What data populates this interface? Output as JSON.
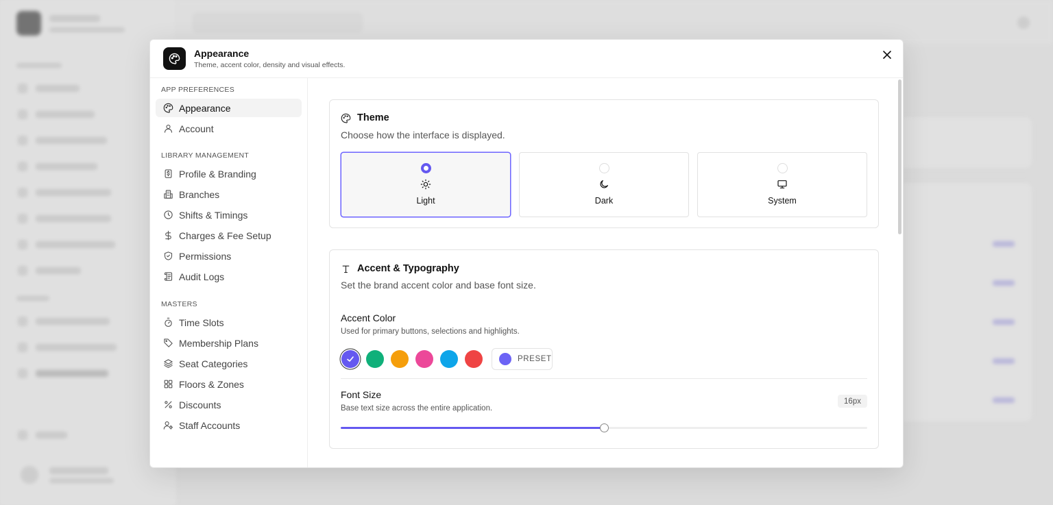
{
  "modal": {
    "title": "Appearance",
    "subtitle": "Theme, accent color, density and visual effects."
  },
  "nav": {
    "sections": [
      {
        "title": "APP PREFERENCES",
        "items": [
          {
            "label": "Appearance",
            "icon": "palette-icon",
            "active": true
          },
          {
            "label": "Account",
            "icon": "user-icon"
          }
        ]
      },
      {
        "title": "LIBRARY MANAGEMENT",
        "items": [
          {
            "label": "Profile & Branding",
            "icon": "badge-icon"
          },
          {
            "label": "Branches",
            "icon": "building-icon"
          },
          {
            "label": "Shifts & Timings",
            "icon": "clock-icon"
          },
          {
            "label": "Charges & Fee Setup",
            "icon": "dollar-icon"
          },
          {
            "label": "Permissions",
            "icon": "shield-check-icon"
          },
          {
            "label": "Audit Logs",
            "icon": "scroll-icon"
          }
        ]
      },
      {
        "title": "MASTERS",
        "items": [
          {
            "label": "Time Slots",
            "icon": "timer-icon"
          },
          {
            "label": "Membership Plans",
            "icon": "tag-icon"
          },
          {
            "label": "Seat Categories",
            "icon": "layers-icon"
          },
          {
            "label": "Floors & Zones",
            "icon": "grid-icon"
          },
          {
            "label": "Discounts",
            "icon": "percent-icon"
          },
          {
            "label": "Staff Accounts",
            "icon": "user-cog-icon"
          }
        ]
      }
    ]
  },
  "theme": {
    "title": "Theme",
    "subtitle": "Choose how the interface is displayed.",
    "options": [
      {
        "label": "Light",
        "icon": "sun-icon",
        "selected": true
      },
      {
        "label": "Dark",
        "icon": "moon-icon",
        "selected": false
      },
      {
        "label": "System",
        "icon": "monitor-icon",
        "selected": false
      }
    ]
  },
  "accent": {
    "title": "Accent & Typography",
    "subtitle": "Set the brand accent color and base font size.",
    "color_label": "Accent Color",
    "color_help": "Used for primary buttons, selections and highlights.",
    "swatches": [
      "#6458f0",
      "#10b07a",
      "#f59e0b",
      "#ec4899",
      "#0ea5e9",
      "#ef4444"
    ],
    "selected_swatch": 0,
    "preset_label": "PRESET",
    "preset_color": "#6c63f5",
    "font_label": "Font Size",
    "font_help": "Base text size across the entire application.",
    "font_value": "16px",
    "font_slider_fraction": 0.5
  },
  "colors": {
    "accent": "#6458f0",
    "border": "#e3e3e3"
  }
}
